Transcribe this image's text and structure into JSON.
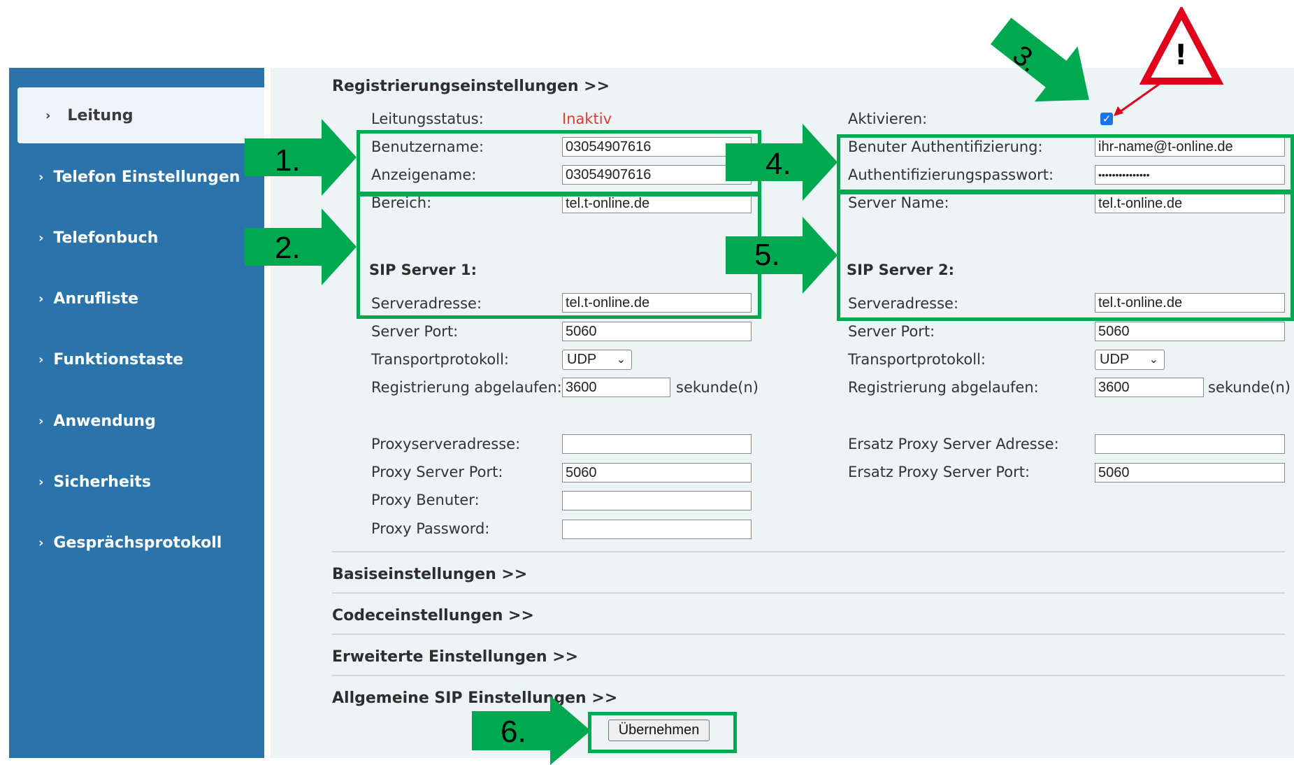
{
  "sidebar": {
    "items": [
      {
        "label": "Leitung"
      },
      {
        "label": "Telefon Einstellungen"
      },
      {
        "label": "Telefonbuch"
      },
      {
        "label": "Anrufliste"
      },
      {
        "label": "Funktionstaste"
      },
      {
        "label": "Anwendung"
      },
      {
        "label": "Sicherheits"
      },
      {
        "label": "Gesprächsprotokoll"
      }
    ]
  },
  "sections": {
    "registration": "Registrierungseinstellungen >>",
    "basic": "Basiseinstellungen >>",
    "codec": "Codeceinstellungen >>",
    "advanced": "Erweiterte Einstellungen >>",
    "general_sip": "Allgemeine SIP Einstellungen >>"
  },
  "left": {
    "line_status_label": "Leitungsstatus:",
    "line_status_value": "Inaktiv",
    "username_label": "Benutzername:",
    "username_value": "03054907616",
    "display_name_label": "Anzeigename:",
    "display_name_value": "03054907616",
    "realm_label": "Bereich:",
    "realm_value": "tel.t-online.de",
    "sip_server_title": "SIP Server 1:",
    "server_address_label": "Serveradresse:",
    "server_address_value": "tel.t-online.de",
    "server_port_label": "Server Port:",
    "server_port_value": "5060",
    "transport_label": "Transportprotokoll:",
    "transport_value": "UDP",
    "reg_expiry_label": "Registrierung abgelaufen:",
    "reg_expiry_value": "3600",
    "reg_expiry_unit": "sekunde(n)",
    "proxy_address_label": "Proxyserveradresse:",
    "proxy_address_value": "",
    "proxy_port_label": "Proxy Server Port:",
    "proxy_port_value": "5060",
    "proxy_user_label": "Proxy Benuter:",
    "proxy_user_value": "",
    "proxy_password_label": "Proxy Password:",
    "proxy_password_value": ""
  },
  "right": {
    "activate_label": "Aktivieren:",
    "activate_checked": true,
    "auth_user_label": "Benuter Authentifizierung:",
    "auth_user_value": "ihr-name@t-online.de",
    "auth_password_label": "Authentifizierungspasswort:",
    "auth_password_value": "•••••••••••••••",
    "server_name_label": "Server Name:",
    "server_name_value": "tel.t-online.de",
    "sip_server_title": "SIP Server 2:",
    "server_address_label": "Serveradresse:",
    "server_address_value": "tel.t-online.de",
    "server_port_label": "Server Port:",
    "server_port_value": "5060",
    "transport_label": "Transportprotokoll:",
    "transport_value": "UDP",
    "reg_expiry_label": "Registrierung abgelaufen:",
    "reg_expiry_value": "3600",
    "reg_expiry_unit": "sekunde(n)",
    "backup_proxy_address_label": "Ersatz Proxy Server Adresse:",
    "backup_proxy_address_value": "",
    "backup_proxy_port_label": "Ersatz Proxy Server Port:",
    "backup_proxy_port_value": "5060"
  },
  "apply_button": "Übernehmen",
  "annotations": {
    "step1": "1.",
    "step2": "2.",
    "step3": "3.",
    "step4": "4.",
    "step5": "5.",
    "step6": "6.",
    "warning": "!"
  },
  "colors": {
    "sidebar_bg": "#2b74ab",
    "main_bg": "#edf4f6",
    "highlight_green": "#00a94f",
    "status_red": "#e23a2a",
    "warning_red": "#e0001a"
  }
}
